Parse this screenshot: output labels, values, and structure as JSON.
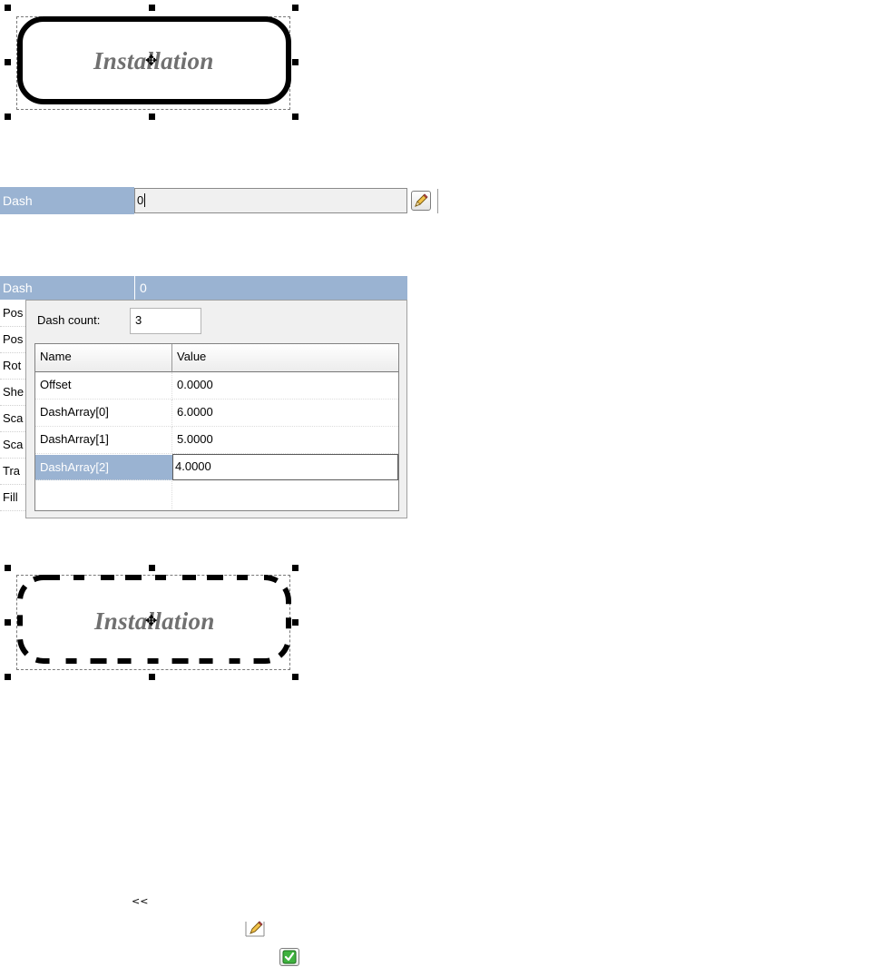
{
  "shape_top": {
    "text": "Installation",
    "cursor": "✥"
  },
  "dash_field": {
    "label": "Dash",
    "value": "0"
  },
  "property_grid": {
    "header_label": "Dash",
    "header_value": "0",
    "rows": [
      "Pos",
      "Pos",
      "Rot",
      "She",
      "Sca",
      "Sca",
      "Tra",
      "Fill"
    ]
  },
  "dash_popup": {
    "count_label": "Dash count:",
    "count_value": "3",
    "columns": [
      "Name",
      "Value"
    ],
    "rows": [
      {
        "name": "Offset",
        "value": "0.0000"
      },
      {
        "name": "DashArray[0]",
        "value": "6.0000"
      },
      {
        "name": "DashArray[1]",
        "value": "5.0000"
      },
      {
        "name": "DashArray[2]",
        "value": "4.0000"
      },
      {
        "name": "",
        "value": ""
      }
    ],
    "selected_row": 3
  },
  "shape_bottom": {
    "text": "Installation",
    "cursor": "✥"
  },
  "legend": {
    "collapse_label": "<<",
    "edit_icon": "pencil-icon",
    "ok_icon": "checkmark-icon"
  },
  "colors": {
    "selection": "#9ab3d2",
    "shape_text": "#707070",
    "ok_check": "#2e9a2e"
  }
}
